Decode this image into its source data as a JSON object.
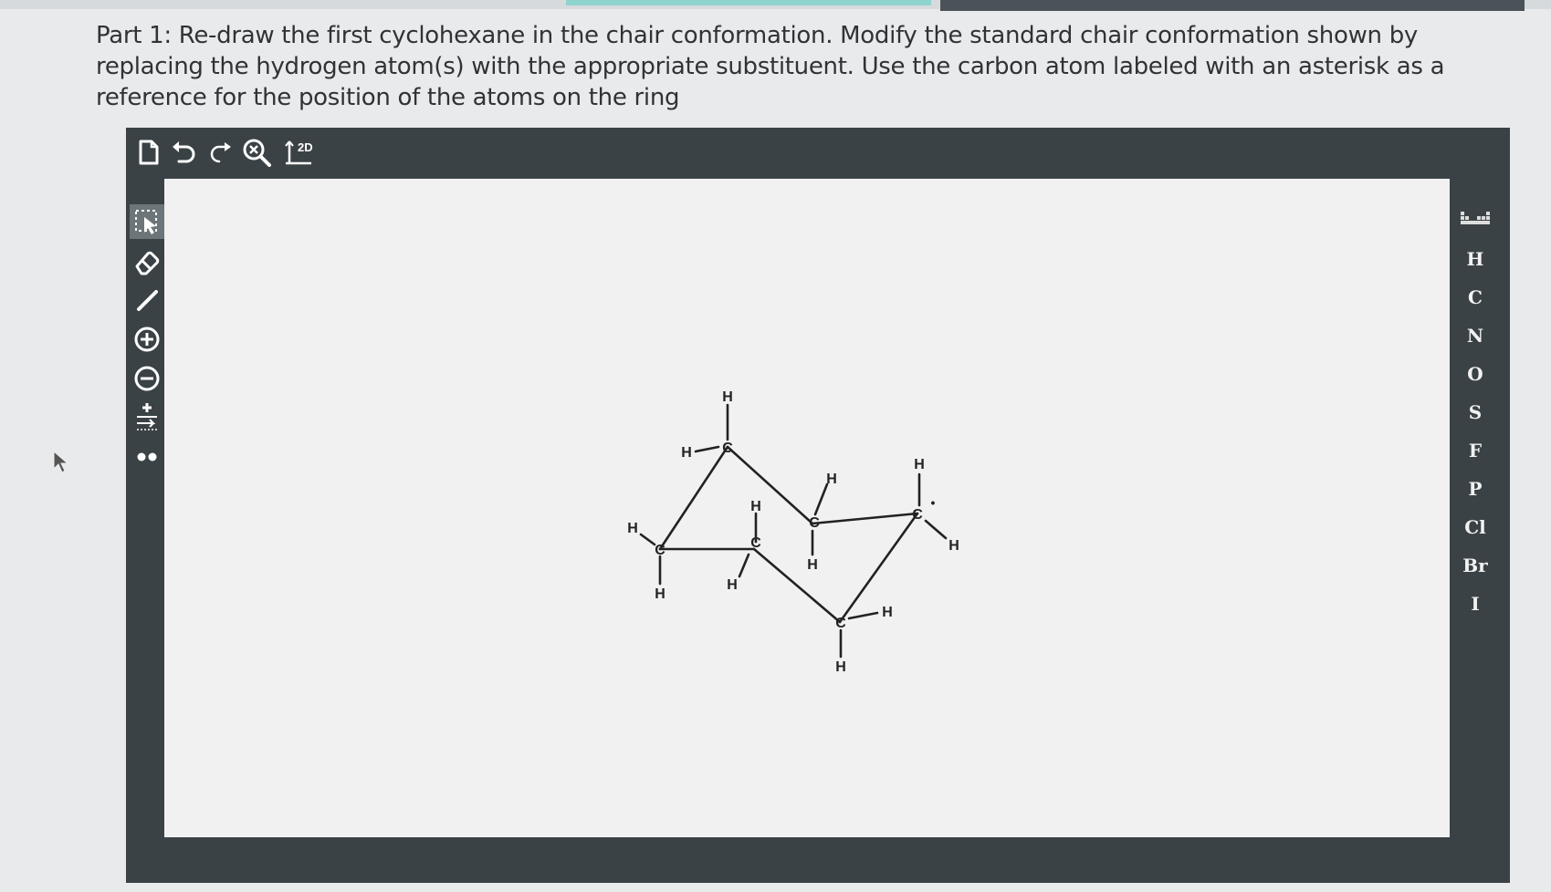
{
  "question": {
    "text": "Part 1: Re-draw the first cyclohexane in the chair conformation. Modify the standard chair conformation shown by replacing the hydrogen atom(s) with the appropriate substituent. Use the carbon atom labeled with an asterisk as a reference for the position of the atoms on the ring"
  },
  "toolbar_top": {
    "icons": [
      "new-document-icon",
      "undo-icon",
      "redo-icon",
      "zoom-reset-icon",
      "clean-2d-icon"
    ],
    "clean_label": "2D"
  },
  "toolbar_left": {
    "icons": [
      "selection-icon",
      "eraser-icon",
      "single-bond-icon",
      "positive-charge-icon",
      "negative-charge-icon",
      "charge-adjust-icon",
      "lone-pair-icon"
    ],
    "active": "selection-icon"
  },
  "element_bar": {
    "elements": [
      "H",
      "C",
      "N",
      "O",
      "S",
      "F",
      "P",
      "Cl",
      "Br",
      "I"
    ]
  },
  "molecule": {
    "carbon_label": "C",
    "hydrogen_label": "H",
    "asterisk_mark": "•"
  },
  "colors": {
    "editor_frame": "#3a4246",
    "canvas": "#f1f1f2",
    "icon": "#ffffff",
    "accent": "#8fd3cf"
  }
}
